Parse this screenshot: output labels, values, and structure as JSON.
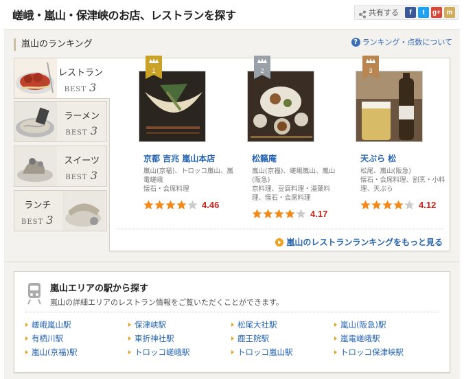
{
  "header": {
    "title": "嵯峨・嵐山・保津峡のお店、レストランを探す",
    "share_label": "共有する",
    "sns": [
      {
        "icon": "facebook-icon",
        "glyph": "f",
        "color": "#3b5998"
      },
      {
        "icon": "twitter-icon",
        "glyph": "t",
        "color": "#1da1f2"
      },
      {
        "icon": "google-plus-icon",
        "glyph": "g+",
        "color": "#d34836"
      },
      {
        "icon": "mixi-icon",
        "glyph": "m",
        "color": "#d1ad59"
      }
    ]
  },
  "ranking": {
    "heading": "嵐山のランキング",
    "help_link": "ランキング・点数について",
    "categories": [
      {
        "label": "レストラン",
        "sub": "BEST",
        "num": "3",
        "active": true
      },
      {
        "label": "ラーメン",
        "sub": "BEST",
        "num": "3",
        "active": false
      },
      {
        "label": "スイーツ",
        "sub": "BEST",
        "num": "3",
        "active": false
      },
      {
        "label": "ランチ",
        "sub": "BEST",
        "num": "3",
        "active": false
      }
    ],
    "shops": [
      {
        "rank": "1",
        "name": "京都 吉兆 嵐山本店",
        "area": "嵐山(京福)、トロッコ嵐山、嵐電嵯峨",
        "genre": "懐石・会席料理",
        "rating": 4.46,
        "score": "4.46",
        "crown_color": "#c9a227"
      },
      {
        "rank": "2",
        "name": "松籟庵",
        "area": "嵐山(京福)、嵯峨嵐山、嵐山(阪急)",
        "genre": "京料理、豆腐料理・湯葉料理、懐石・会席料理",
        "rating": 4.17,
        "score": "4.17",
        "crown_color": "#9aa0a8"
      },
      {
        "rank": "3",
        "name": "天ぷら 松",
        "area": "松尾、嵐山(阪急)",
        "genre": "懐石・会席料理、割烹・小料理、天ぷら",
        "rating": 4.12,
        "score": "4.12",
        "crown_color": "#b98551"
      }
    ],
    "more_link": "嵐山のレストランランキングをもっと見る",
    "star_color": "#f08a19",
    "score_color": "#c8241a"
  },
  "stations": {
    "title": "嵐山エリアの駅から探す",
    "description": "嵐山の詳細エリアのレストラン情報をご覧いただくことができます。",
    "links": [
      "嵯峨嵐山駅",
      "保津峡駅",
      "松尾大社駅",
      "嵐山(阪急)駅",
      "有栖川駅",
      "車折神社駅",
      "鹿王院駅",
      "嵐電嵯峨駅",
      "嵐山(京福)駅",
      "トロッコ嵯峨駅",
      "トロッコ嵐山駅",
      "トロッコ保津峡駅"
    ]
  }
}
